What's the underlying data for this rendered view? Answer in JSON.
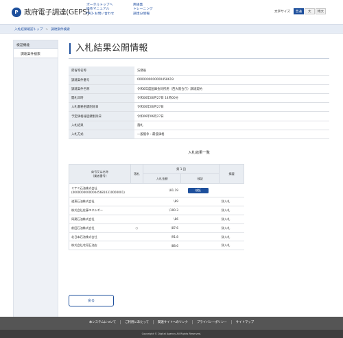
{
  "header": {
    "logo_mark": "P",
    "site_title": "政府電子調達(GEPS)",
    "nav_col1": [
      "ポータルトップへ",
      "操作マニュアル",
      "FAQ･お問い合わせ"
    ],
    "nav_col2": [
      "用語集",
      "トレーニング",
      "調達分情報"
    ],
    "font_size_label": "文字サイズ",
    "font_sizes": [
      "普通",
      "大",
      "特大"
    ],
    "font_size_active": "普通"
  },
  "breadcrumb": {
    "items": [
      "入札結果確認トップ",
      "調達案件検索"
    ],
    "separator": ">"
  },
  "sidebar": {
    "heading": "検証機能",
    "items": [
      "調達案件検索"
    ]
  },
  "main": {
    "title": "入札結果公開情報",
    "info_rows": [
      {
        "label": "府省等名称",
        "value": "法務省"
      },
      {
        "label": "調達案件番号",
        "value": "0000000000000458619"
      },
      {
        "label": "調達案件名称",
        "value": "令和6年度国庫金同所用（西大阪合庁）調達契約"
      },
      {
        "label": "開札日時",
        "value": "令和06年06月27日 14時00分"
      },
      {
        "label": "入札書秘密鍵削除日",
        "value": "令和06年06月27日"
      },
      {
        "label": "予定価格秘密鍵削除日",
        "value": "令和06年06月27日"
      },
      {
        "label": "入札結果",
        "value": "落札"
      },
      {
        "label": "入札方式",
        "value": "一般競争・最低価格"
      }
    ],
    "results_title": "入札結果一覧",
    "results_headers": {
      "company": "商号又は名称\n(業者番号)",
      "won": "落札",
      "round": "第 1 回",
      "amount": "入札金額",
      "verify": "検証",
      "note": "摘要"
    },
    "results_rows": [
      {
        "company": "ミナミ石油株式会社",
        "company_no": "(0000000000000456810310000001)",
        "won": "",
        "amount": "\\81.19",
        "verify": "検証",
        "note": ""
      },
      {
        "company": "道東石油株式会社",
        "company_no": "",
        "won": "",
        "amount": "\\89",
        "verify": "",
        "note": "辞入札"
      },
      {
        "company": "株式会社佐藤エネルギー",
        "company_no": "",
        "won": "",
        "amount": "\\100.3",
        "verify": "",
        "note": "辞入札"
      },
      {
        "company": "岡建石油株式会社",
        "company_no": "",
        "won": "",
        "amount": "\\86",
        "verify": "",
        "note": "辞入札"
      },
      {
        "company": "前田石油株式会社",
        "company_no": "",
        "won": "○",
        "amount": "\\87.6",
        "verify": "",
        "note": "辞入札"
      },
      {
        "company": "北日本石油株式会社",
        "company_no": "",
        "won": "",
        "amount": "\\91.8",
        "verify": "",
        "note": "辞入札"
      },
      {
        "company": "株式会社北見石油店",
        "company_no": "",
        "won": "",
        "amount": "\\88.6",
        "verify": "",
        "note": "辞入札"
      }
    ],
    "back_label": "戻る"
  },
  "footer": {
    "links": [
      "本システムについて",
      "ご利用にあたって",
      "関連サイトへのリンク",
      "プライバシーポリシー",
      "サイトマップ"
    ],
    "copyright": "Copyright © Digital Agency All Rights Reserved."
  },
  "colors": {
    "brand": "#1d4f9c",
    "breadcrumb_bg": "#e6ecf5",
    "footer_bg": "#555555"
  }
}
